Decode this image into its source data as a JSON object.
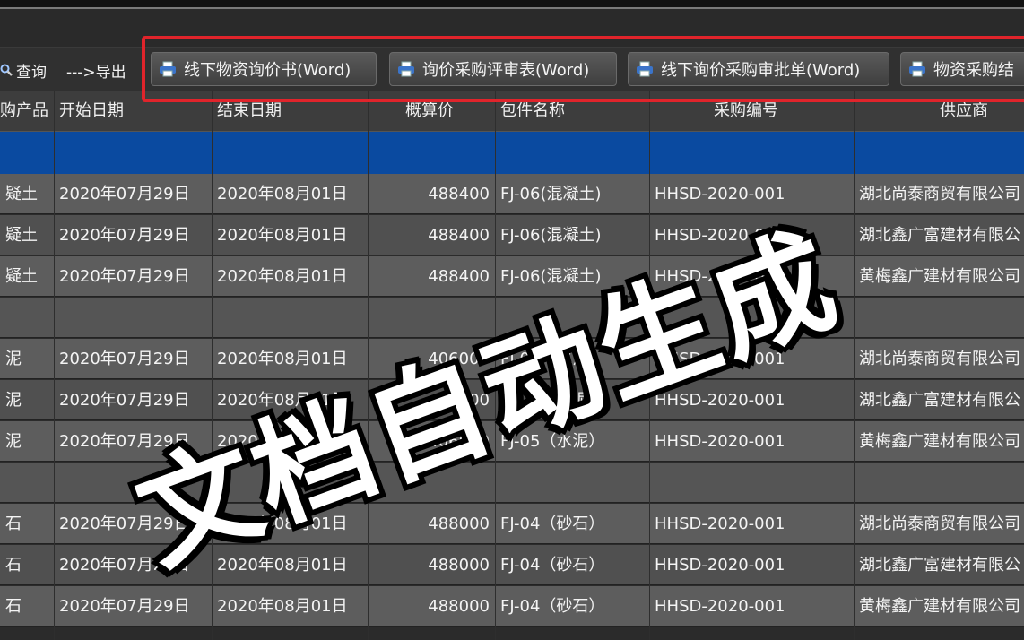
{
  "toolbar": {
    "query_label": "查询",
    "export_label": "--->导出",
    "buttons": [
      "线下物资询价书(Word)",
      "询价采购评审表(Word)",
      "线下询价采购审批单(Word)",
      "物资采购结"
    ]
  },
  "grid": {
    "headers": [
      "购产品",
      "开始日期",
      "结束日期",
      "概算价",
      "包件名称",
      "采购编号",
      "供应商"
    ],
    "rows": [
      [
        "疑土",
        "2020年07月29日",
        "2020年08月01日",
        "488400",
        "FJ-06(混凝土)",
        "HHSD-2020-001",
        "湖北尚泰商贸有限公司"
      ],
      [
        "疑土",
        "2020年07月29日",
        "2020年08月01日",
        "488400",
        "FJ-06(混凝土)",
        "HHSD-2020-001",
        "湖北鑫广富建材有限公"
      ],
      [
        "疑土",
        "2020年07月29日",
        "2020年08月01日",
        "488400",
        "FJ-06(混凝土)",
        "HHSD-2020-001",
        "黄梅鑫广建材有限公司"
      ],
      [
        "",
        "",
        "",
        "",
        "",
        "",
        ""
      ],
      [
        "泥",
        "2020年07月29日",
        "2020年08月01日",
        "406000",
        "FJ-05（水泥）",
        "HHSD-2020-001",
        "湖北尚泰商贸有限公司"
      ],
      [
        "泥",
        "2020年07月29日",
        "2020年08月01日",
        "406000",
        "FJ-05（水泥）",
        "HHSD-2020-001",
        "湖北鑫广富建材有限公"
      ],
      [
        "泥",
        "2020年07月29日",
        "2020年08月01日",
        "406000",
        "FJ-05（水泥）",
        "HHSD-2020-001",
        "黄梅鑫广建材有限公司"
      ],
      [
        "",
        "",
        "",
        "",
        "",
        "",
        ""
      ],
      [
        "石",
        "2020年07月29日",
        "2020年08月01日",
        "488000",
        "FJ-04（砂石）",
        "HHSD-2020-001",
        "湖北尚泰商贸有限公司"
      ],
      [
        "石",
        "2020年07月29日",
        "2020年08月01日",
        "488000",
        "FJ-04（砂石）",
        "HHSD-2020-001",
        "湖北鑫广富建材有限公"
      ],
      [
        "石",
        "2020年07月29日",
        "2020年08月01日",
        "488000",
        "FJ-04（砂石）",
        "HHSD-2020-001",
        "黄梅鑫广建材有限公司"
      ]
    ]
  },
  "overlay": {
    "text": "文档自动生成"
  },
  "colors": {
    "highlight_box": "#e0242b",
    "selected_row": "#0a4aa0"
  }
}
